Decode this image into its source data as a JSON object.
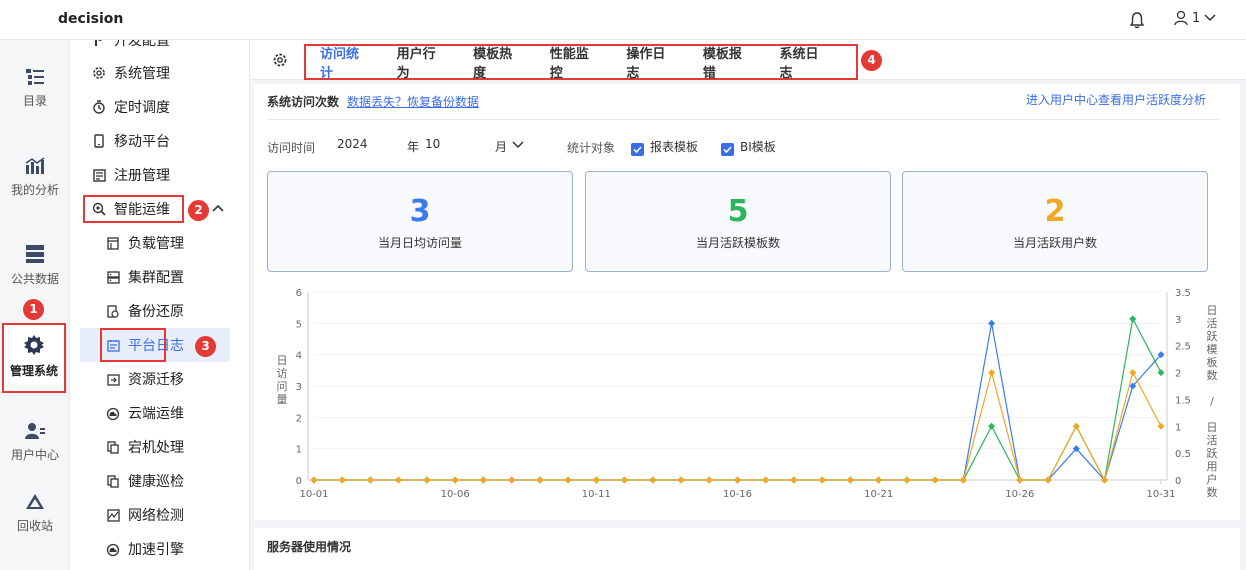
{
  "app": {
    "title": "decision",
    "user_label": "1"
  },
  "rail": [
    {
      "label": "目录",
      "icon": "directory-icon"
    },
    {
      "label": "我的分析",
      "icon": "analysis-icon"
    },
    {
      "label": "公共数据",
      "icon": "public-data-icon"
    },
    {
      "label": "管理系统",
      "icon": "system-gear-icon"
    },
    {
      "label": "用户中心",
      "icon": "user-center-icon"
    },
    {
      "label": "回收站",
      "icon": "recycle-icon"
    }
  ],
  "menu": {
    "top_partial": "开发配置",
    "items": [
      {
        "label": "系统管理",
        "icon": "gear-icon"
      },
      {
        "label": "定时调度",
        "icon": "timer-icon"
      },
      {
        "label": "移动平台",
        "icon": "mobile-icon"
      },
      {
        "label": "注册管理",
        "icon": "register-icon"
      },
      {
        "label": "智能运维",
        "icon": "smart-ops-icon"
      }
    ],
    "sub": [
      {
        "label": "负载管理",
        "icon": "load-icon"
      },
      {
        "label": "集群配置",
        "icon": "cluster-icon"
      },
      {
        "label": "备份还原",
        "icon": "backup-icon"
      },
      {
        "label": "平台日志",
        "icon": "log-icon"
      },
      {
        "label": "资源迁移",
        "icon": "migrate-icon"
      },
      {
        "label": "云端运维",
        "icon": "cloud-icon"
      },
      {
        "label": "宕机处理",
        "icon": "crash-icon"
      },
      {
        "label": "健康巡检",
        "icon": "health-icon"
      },
      {
        "label": "网络检测",
        "icon": "network-icon"
      },
      {
        "label": "加速引擎",
        "icon": "engine-icon"
      }
    ]
  },
  "badges": [
    "1",
    "2",
    "3",
    "4"
  ],
  "tabs": [
    "访问统计",
    "用户行为",
    "模板热度",
    "性能监控",
    "操作日志",
    "模板报错",
    "系统日志"
  ],
  "section": {
    "title": "系统访问次数",
    "restore_link": "数据丢失？恢复备份数据",
    "right_link": "进入用户中心查看用户活跃度分析",
    "time_label": "访问时间",
    "year": "2024",
    "year_unit": "年",
    "month": "10",
    "month_unit": "月",
    "target_label": "统计对象",
    "cb1": "报表模板",
    "cb2": "BI模板"
  },
  "cards": [
    {
      "value": "3",
      "label": "当月日均访问量",
      "color": "#3a7bf0"
    },
    {
      "value": "5",
      "label": "当月活跃模板数",
      "color": "#2bb55a"
    },
    {
      "value": "2",
      "label": "当月活跃用户数",
      "color": "#f5a623"
    }
  ],
  "footer": {
    "title": "服务器使用情况"
  },
  "chart_data": {
    "type": "line",
    "x": [
      "10-01",
      "10-02",
      "10-03",
      "10-04",
      "10-05",
      "10-06",
      "10-07",
      "10-08",
      "10-09",
      "10-10",
      "10-11",
      "10-12",
      "10-13",
      "10-14",
      "10-15",
      "10-16",
      "10-17",
      "10-18",
      "10-19",
      "10-20",
      "10-21",
      "10-22",
      "10-23",
      "10-24",
      "10-25",
      "10-26",
      "10-27",
      "10-28",
      "10-29",
      "10-30",
      "10-31"
    ],
    "xticks": [
      "10-01",
      "10-06",
      "10-11",
      "10-16",
      "10-21",
      "10-26",
      "10-31"
    ],
    "ylabel_left": "日访问量",
    "ylabel_right": "日活跃模板数 / 日活跃用户数",
    "ylim_left": [
      0,
      6
    ],
    "yticks_left": [
      "0",
      "1",
      "2",
      "3",
      "4",
      "5",
      "6"
    ],
    "ylim_right": [
      0,
      3.5
    ],
    "yticks_right": [
      "0",
      "0.5",
      "1",
      "1.5",
      "2",
      "2.5",
      "3",
      "3.5"
    ],
    "series": [
      {
        "axis": "left",
        "color": "#3a7bf0",
        "values": [
          0,
          0,
          0,
          0,
          0,
          0,
          0,
          0,
          0,
          0,
          0,
          0,
          0,
          0,
          0,
          0,
          0,
          0,
          0,
          0,
          0,
          0,
          0,
          0,
          5,
          0,
          0,
          1,
          0,
          3,
          4
        ]
      },
      {
        "axis": "right",
        "color": "#2bb55a",
        "values": [
          0,
          0,
          0,
          0,
          0,
          0,
          0,
          0,
          0,
          0,
          0,
          0,
          0,
          0,
          0,
          0,
          0,
          0,
          0,
          0,
          0,
          0,
          0,
          0,
          1,
          0,
          0,
          1,
          0,
          3,
          2
        ]
      },
      {
        "axis": "right",
        "color": "#f5a623",
        "values": [
          0,
          0,
          0,
          0,
          0,
          0,
          0,
          0,
          0,
          0,
          0,
          0,
          0,
          0,
          0,
          0,
          0,
          0,
          0,
          0,
          0,
          0,
          0,
          0,
          2,
          0,
          0,
          1,
          0,
          2,
          1
        ]
      }
    ]
  }
}
